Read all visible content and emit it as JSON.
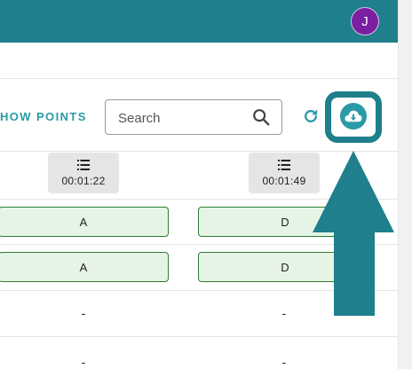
{
  "header": {
    "avatar_initial": "J"
  },
  "toolbar": {
    "show_points_label": "HOW POINTS",
    "search_placeholder": "Search"
  },
  "columns": [
    {
      "time": "00:01:22"
    },
    {
      "time": "00:01:49"
    }
  ],
  "rows": [
    {
      "cells": [
        "A",
        "D"
      ]
    },
    {
      "cells": [
        "A",
        "D"
      ]
    },
    {
      "cells": [
        "-",
        "-"
      ]
    },
    {
      "cells": [
        "-",
        "-"
      ]
    }
  ],
  "colors": {
    "header": "#1f7f8c",
    "accent": "#2a9aa6",
    "avatar": "#7b1fa2",
    "answer_bg": "#e6f4e6",
    "answer_border": "#2e7d32"
  },
  "icons": [
    "search-icon",
    "refresh-icon",
    "cloud-download-icon",
    "list-icon",
    "pointer-arrow"
  ]
}
